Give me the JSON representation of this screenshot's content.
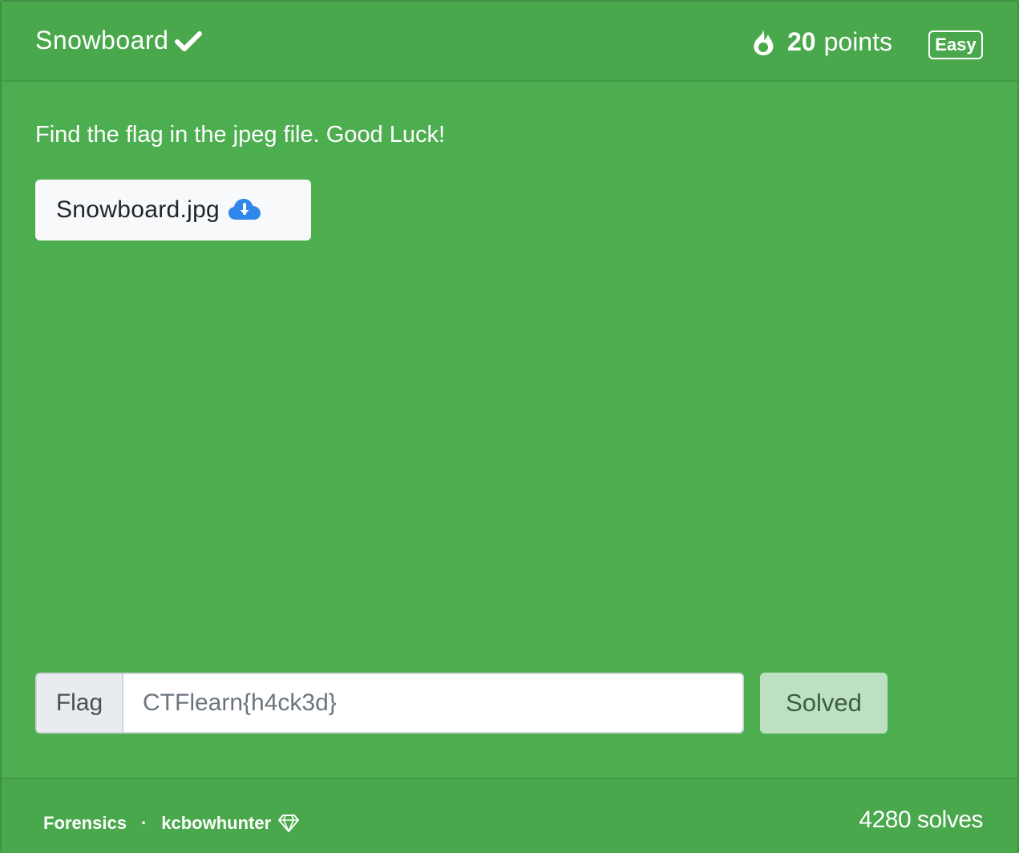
{
  "challenge": {
    "title": "Snowboard",
    "points_value": "20",
    "points_label": "points",
    "difficulty": "Easy",
    "description": "Find the flag in the jpeg file. Good Luck!",
    "file_name": "Snowboard.jpg",
    "solved": true
  },
  "flag_form": {
    "label": "Flag",
    "placeholder": "CTFlearn{h4ck3d}",
    "submit_label": "Solved"
  },
  "footer": {
    "category": "Forensics",
    "separator": "·",
    "author": "kcbowhunter",
    "solves": "4280 solves"
  },
  "icons": {
    "solved": "check-icon",
    "points": "fire-icon",
    "download": "cloud-download-icon",
    "author_badge": "diamond-icon"
  },
  "colors": {
    "card_bg": "#4cae4f",
    "header_bg": "#49a84c",
    "button_light": "#f8f9fa",
    "solved_button_bg": "#bde0c2",
    "download_icon": "#2f86eb"
  }
}
